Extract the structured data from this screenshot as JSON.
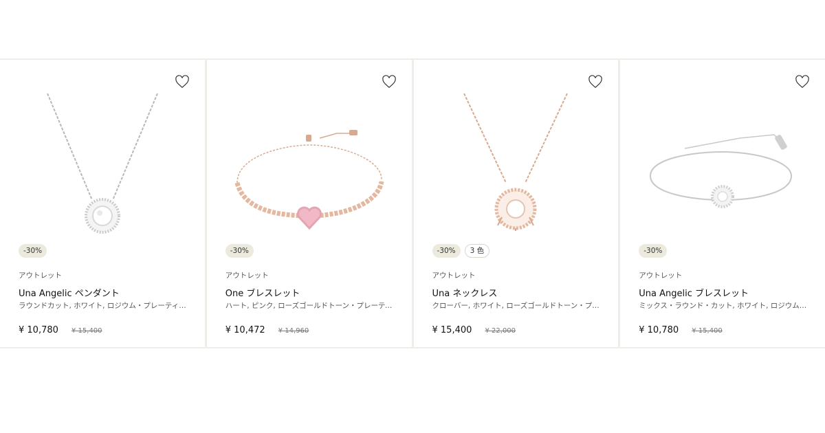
{
  "products": [
    {
      "badge": "-30%",
      "label": "アウトレット",
      "name": "Una Angelic ペンダント",
      "desc": "ラウンドカット, ホワイト, ロジウム・プレーティン…",
      "price": "¥ 10,780",
      "old_price": "¥ 15,400",
      "fav_icon": "heart-icon",
      "metal_color": "#c4c4c4"
    },
    {
      "badge": "-30%",
      "label": "アウトレット",
      "name": "One ブレスレット",
      "desc": "ハート, ピンク, ローズゴールドトーン・プレーティ…",
      "price": "¥ 10,472",
      "old_price": "¥ 14,960",
      "fav_icon": "heart-icon",
      "metal_color": "#d9a98f"
    },
    {
      "badge": "-30%",
      "colors_badge": "3 色",
      "label": "アウトレット",
      "name": "Una ネックレス",
      "desc": "クローバー, ホワイト, ローズゴールドトーン・プレ…",
      "price": "¥ 15,400",
      "old_price": "¥ 22,000",
      "fav_icon": "heart-icon",
      "metal_color": "#d9a98f"
    },
    {
      "badge": "-30%",
      "label": "アウトレット",
      "name": "Una Angelic ブレスレット",
      "desc": "ミックス・ラウンド・カット, ホワイト, ロジウム・…",
      "price": "¥ 10,780",
      "old_price": "¥ 15,400",
      "fav_icon": "heart-icon",
      "metal_color": "#c4c4c4"
    }
  ]
}
